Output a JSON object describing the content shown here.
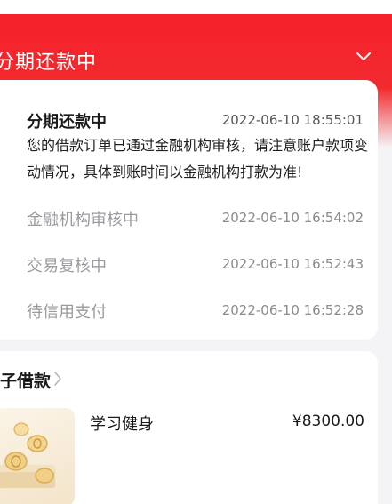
{
  "header": {
    "title": "分期还款中"
  },
  "status_card": {
    "main": {
      "label": "分期还款中",
      "time": "2022-06-10 18:55:01",
      "description": "您的借款订单已通过金融机构审核，请注意账户款项变动情况，具体到账时间以金融机构打款为准!"
    },
    "history": [
      {
        "label": "金融机构审核中",
        "time": "2022-06-10 16:54:02"
      },
      {
        "label": "交易复核中",
        "time": "2022-06-10 16:52:43"
      },
      {
        "label": "待信用支付",
        "time": "2022-06-10 16:52:28"
      }
    ]
  },
  "loan_card": {
    "title": "子借款",
    "item": {
      "name": "学习健身",
      "amount": "¥8300.00"
    }
  },
  "colors": {
    "brand_red": "#f5212a",
    "text_primary": "#1a1a1a",
    "text_muted": "#9a9a9f"
  },
  "icons": {
    "header_toggle": "chevron-down-icon",
    "loan_link": "chevron-right-icon",
    "item_thumbnail": "coins-illustration"
  }
}
